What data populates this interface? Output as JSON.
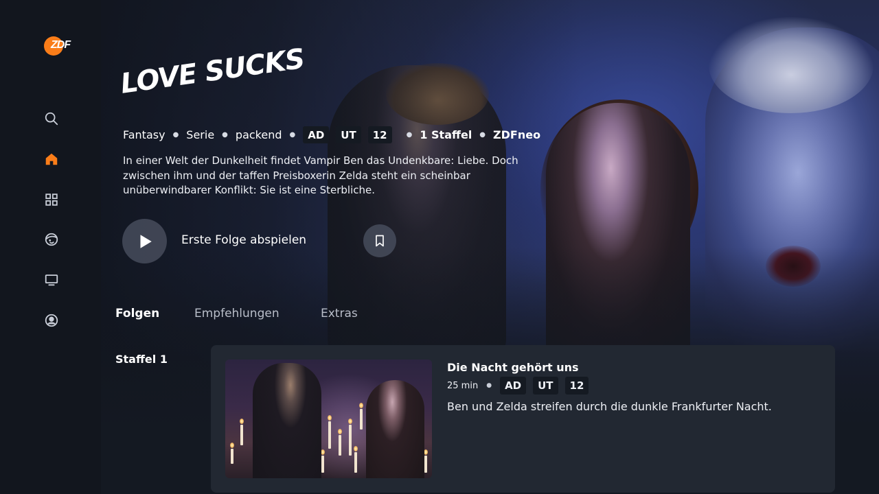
{
  "brand": {
    "logo_text": "ZDF",
    "accent_color": "#fa7d19"
  },
  "sidebar": {
    "items": [
      {
        "icon": "search-icon",
        "label": "Suche",
        "active": false
      },
      {
        "icon": "home-icon",
        "label": "Startseite",
        "active": true
      },
      {
        "icon": "categories-icon",
        "label": "Kategorien",
        "active": false
      },
      {
        "icon": "kids-icon",
        "label": "Kinder",
        "active": false
      },
      {
        "icon": "tv-icon",
        "label": "Live-TV",
        "active": false
      },
      {
        "icon": "profile-icon",
        "label": "Profil",
        "active": false
      }
    ]
  },
  "show": {
    "title": "Love Sucks",
    "meta": {
      "genre": "Fantasy",
      "type": "Serie",
      "mood": "packend",
      "badges": [
        "AD",
        "UT",
        "12"
      ],
      "seasons": "1 Staffel",
      "channel": "ZDFneo"
    },
    "description": "In einer Welt der Dunkelheit findet Vampir Ben das Undenkbare: Liebe. Doch zwischen ihm und der taffen Preisboxerin Zelda steht ein scheinbar unüberwindbarer Konflikt: Sie ist eine Sterbliche.",
    "play_label": "Erste Folge abspielen"
  },
  "tabs": [
    {
      "label": "Folgen",
      "active": true
    },
    {
      "label": "Empfehlungen",
      "active": false
    },
    {
      "label": "Extras",
      "active": false
    }
  ],
  "season": {
    "label": "Staffel 1"
  },
  "episode": {
    "title": "Die Nacht gehört uns",
    "duration": "25 min",
    "badges": [
      "AD",
      "UT",
      "12"
    ],
    "description": "Ben und Zelda streifen durch die dunkle Frankfurter Nacht."
  }
}
